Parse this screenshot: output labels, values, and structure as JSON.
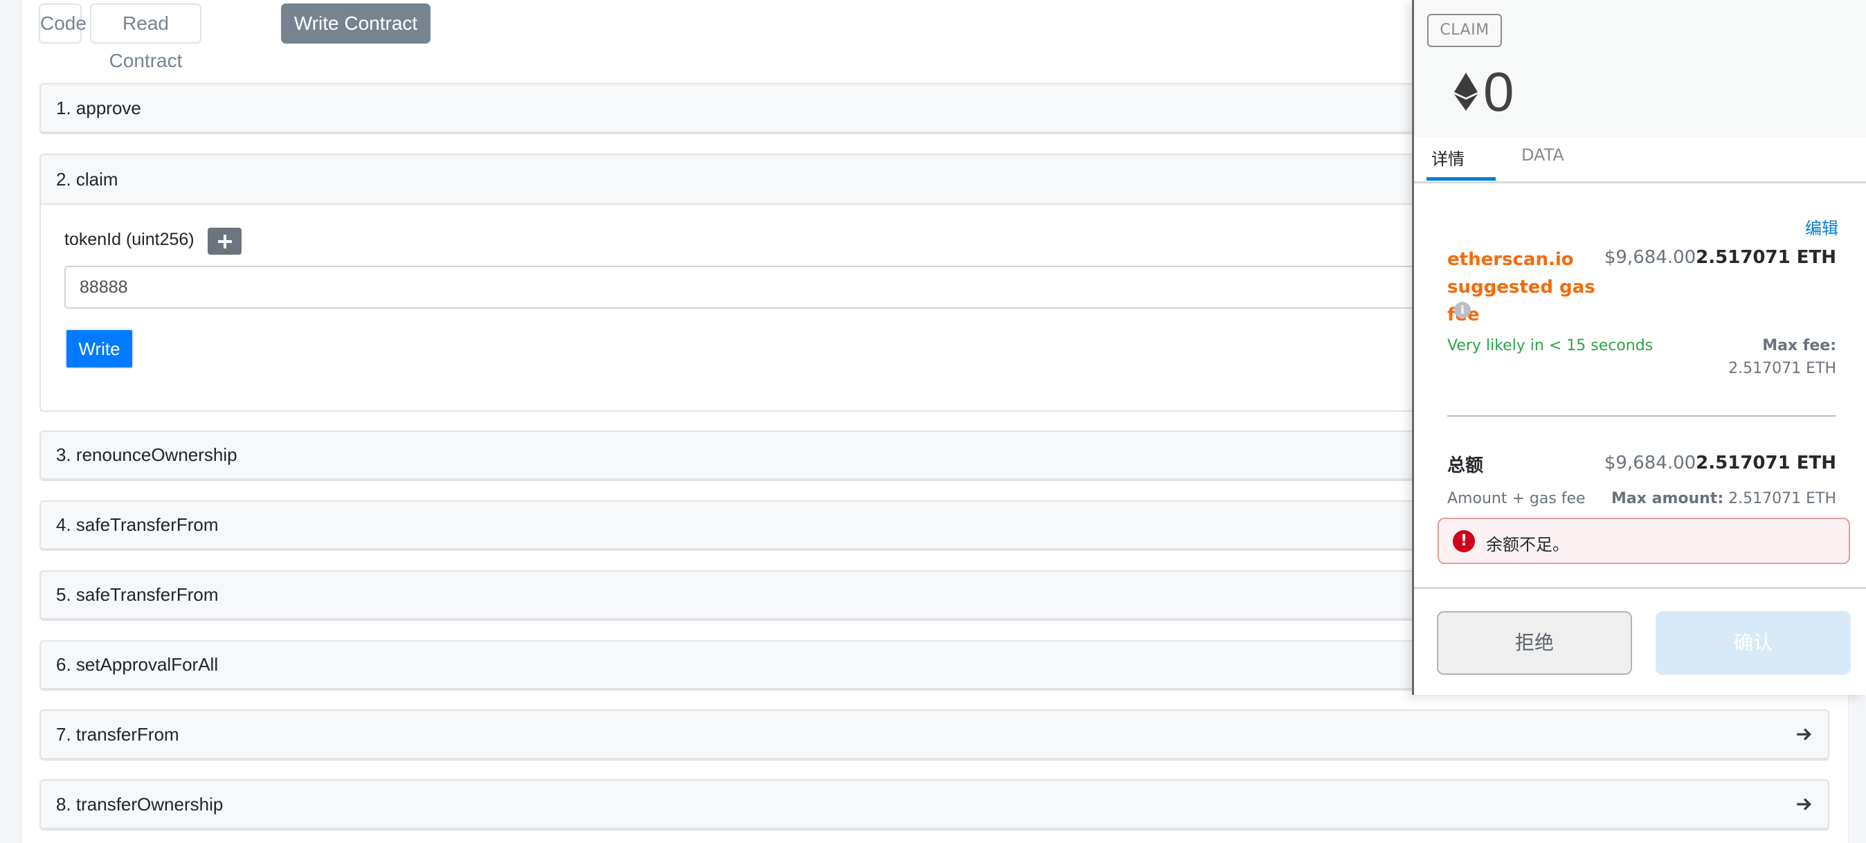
{
  "tabs": [
    {
      "label": "Code",
      "active": false
    },
    {
      "label": "Read Contract",
      "active": false
    },
    {
      "label": "Write Contract",
      "active": true
    }
  ],
  "functions": [
    {
      "label": "1. approve"
    },
    {
      "label": "2. claim",
      "expanded": true,
      "param_label": "tokenId (uint256)",
      "param_value": "88888",
      "write_label": "Write"
    },
    {
      "label": "3. renounceOwnership"
    },
    {
      "label": "4. safeTransferFrom"
    },
    {
      "label": "5. safeTransferFrom"
    },
    {
      "label": "6. setApprovalForAll"
    },
    {
      "label": "7. transferFrom",
      "icon": "arrow-right-icon"
    },
    {
      "label": "8. transferOwnership",
      "icon": "arrow-right-icon"
    }
  ],
  "wallet": {
    "method_badge": "CLAIM",
    "amount": "0",
    "currency_icon": "eth-icon",
    "tabs": [
      {
        "label": "详情",
        "active": true
      },
      {
        "label": "DATA",
        "active": false
      }
    ],
    "edit_label": "编辑",
    "gas_fee_label": "etherscan.io suggested gas fee",
    "gas_fee_fiat": "$9,684.00",
    "gas_fee_eth": "2.517071 ETH",
    "likely_text": "Very likely in < 15 seconds",
    "max_fee_label": "Max fee:",
    "max_fee_value": "2.517071 ETH",
    "total_label": "总额",
    "total_fiat": "$9,684.00",
    "total_eth": "2.517071 ETH",
    "amount_gas_label": "Amount + gas fee",
    "max_amount_label": "Max amount:",
    "max_amount_value": "2.517071 ETH",
    "error_text": "余额不足。",
    "reject_label": "拒绝",
    "confirm_label": "确认",
    "colors": {
      "accent": "#037dd6",
      "gas_label": "#f66a0a",
      "success": "#28a745",
      "error": "#d0021b"
    }
  }
}
